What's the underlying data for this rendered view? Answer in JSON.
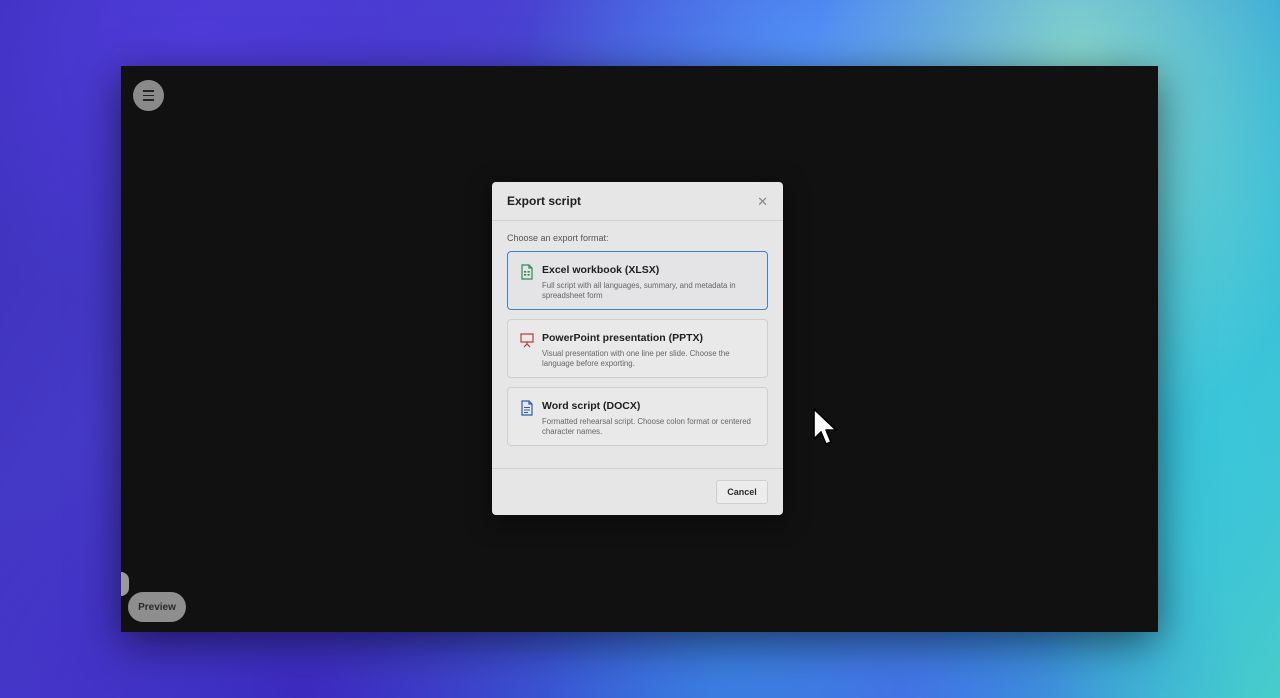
{
  "dialog": {
    "title": "Export script",
    "prompt": "Choose an export format:",
    "options": [
      {
        "title": "Excel workbook (XLSX)",
        "description": "Full script with all languages, summary, and metadata in spreadsheet form",
        "icon": "spreadsheet-icon",
        "icon_color": "#2e8b57",
        "selected": true
      },
      {
        "title": "PowerPoint presentation (PPTX)",
        "description": "Visual presentation with one line per slide. Choose the language before exporting.",
        "icon": "presentation-icon",
        "icon_color": "#c0392b",
        "selected": false
      },
      {
        "title": "Word script (DOCX)",
        "description": "Formatted rehearsal script. Choose colon format or centered character names.",
        "icon": "document-icon",
        "icon_color": "#2a5db0",
        "selected": false
      }
    ],
    "cancel_label": "Cancel"
  },
  "app": {
    "preview_label": "Preview",
    "menu_icon": "hamburger-menu-icon"
  },
  "colors": {
    "accent": "#3b82d6",
    "app_background": "#111111",
    "dialog_background": "#e6e6e6"
  }
}
